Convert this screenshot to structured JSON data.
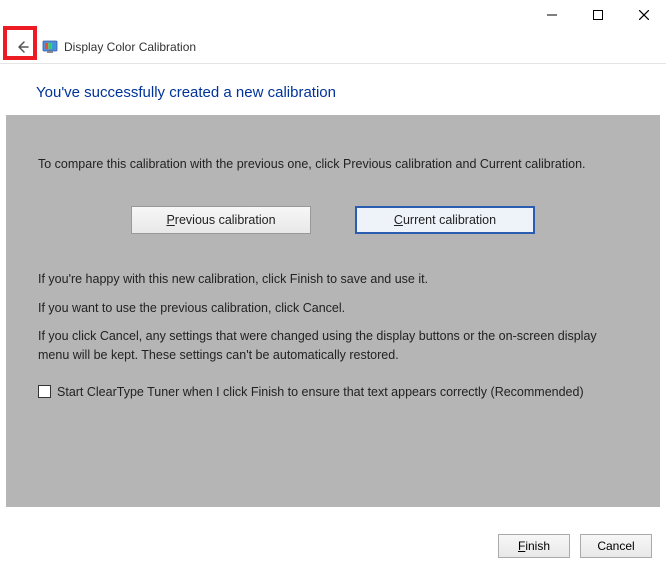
{
  "titlebar": {
    "minimize": "Minimize",
    "maximize": "Maximize",
    "close": "Close"
  },
  "header": {
    "app_title": "Display Color Calibration"
  },
  "heading": "You've successfully created a new calibration",
  "panel": {
    "intro": "To compare this calibration with the previous one, click Previous calibration and Current calibration.",
    "previous_btn_prefix": "P",
    "previous_btn_rest": "revious calibration",
    "current_btn_prefix": "C",
    "current_btn_rest": "urrent calibration",
    "para_happy": "If you're happy with this new calibration, click Finish to save and use it.",
    "para_cancel": "If you want to use the previous calibration, click Cancel.",
    "para_warn": "If you click Cancel, any settings that were changed using the display buttons or the on-screen display menu will be kept. These settings can't be automatically restored.",
    "checkbox_prefix": "S",
    "checkbox_rest": "tart ClearType Tuner when I click Finish to ensure that text appears correctly (Recommended)"
  },
  "footer": {
    "finish_prefix": "F",
    "finish_rest": "inish",
    "cancel": "Cancel"
  }
}
